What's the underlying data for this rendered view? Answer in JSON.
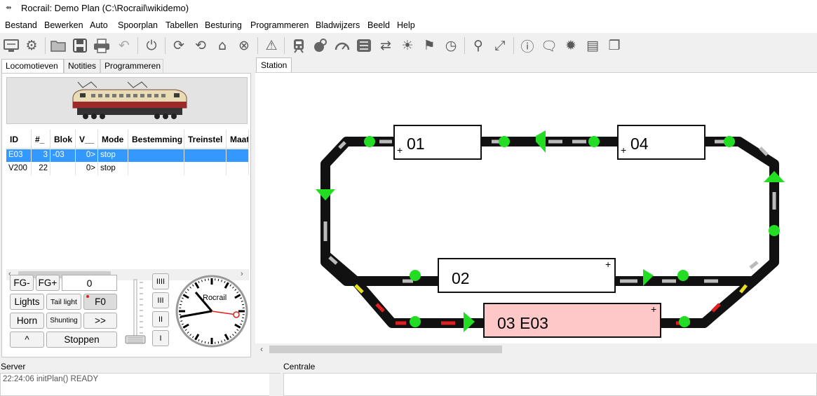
{
  "window": {
    "title": "Rocrail: Demo Plan (C:\\Rocrail\\wikidemo)"
  },
  "menu": [
    "Bestand",
    "Bewerken",
    "Auto",
    "Spoorplan",
    "Tabellen",
    "Besturing",
    "Programmeren",
    "Bladwijzers",
    "Beeld",
    "Help"
  ],
  "toolbar": {
    "icons": [
      "connect-icon",
      "settings-icon",
      "open-folder-icon",
      "save-icon",
      "print-icon",
      "undo-icon",
      "power-icon",
      "reload-icon",
      "reconnect-icon",
      "home-icon",
      "cancel-icon",
      "warning-icon",
      "locomotive-icon",
      "throttle-icon",
      "speedometer-icon",
      "module-icon",
      "shuffle-icon",
      "light-icon",
      "checkered-flag-icon",
      "clock-icon",
      "zoom-icon",
      "fullscreen-icon",
      "info-icon",
      "chat-icon",
      "bug-icon",
      "notes-icon",
      "pages-icon"
    ]
  },
  "left_tabs": [
    "Locomotieven",
    "Notities",
    "Programmeren"
  ],
  "loco_table": {
    "headers": [
      "ID",
      "#_",
      "Blok",
      "V__",
      "Mode",
      "Bestemming",
      "Treinstel",
      "Maat"
    ],
    "rows": [
      [
        "E03",
        "3",
        "-03",
        "0>",
        "stop",
        "",
        "",
        ""
      ],
      [
        "V200",
        "22",
        "",
        "0>",
        "stop",
        "",
        "",
        ""
      ]
    ]
  },
  "throttle": {
    "fg_minus": "FG-",
    "fg_plus": "FG+",
    "fg_value": "0",
    "lights": "Lights",
    "tail_light": "Tail light",
    "f0": "F0",
    "horn": "Horn",
    "shunting": "Shunting",
    "forward": ">>",
    "up": "^",
    "stop": "Stoppen",
    "speed_buttons": [
      "IIII",
      "III",
      "II",
      "I"
    ]
  },
  "clock": {
    "brand": "Rocrail"
  },
  "plan_tab": "Station",
  "blocks": [
    {
      "label": "01",
      "occupied": false
    },
    {
      "label": "04",
      "occupied": false
    },
    {
      "label": "02",
      "occupied": false
    },
    {
      "label": "03 E03",
      "occupied": true
    }
  ],
  "block_marker": "+",
  "server": {
    "title": "Server",
    "log": "22:24:06 initPlan() READY"
  },
  "centrale": {
    "title": "Centrale"
  },
  "colors": {
    "signal_green": "#22dd22",
    "occupied_block": "#ffc8c8",
    "selection": "#3399ff",
    "track": "#111111"
  }
}
